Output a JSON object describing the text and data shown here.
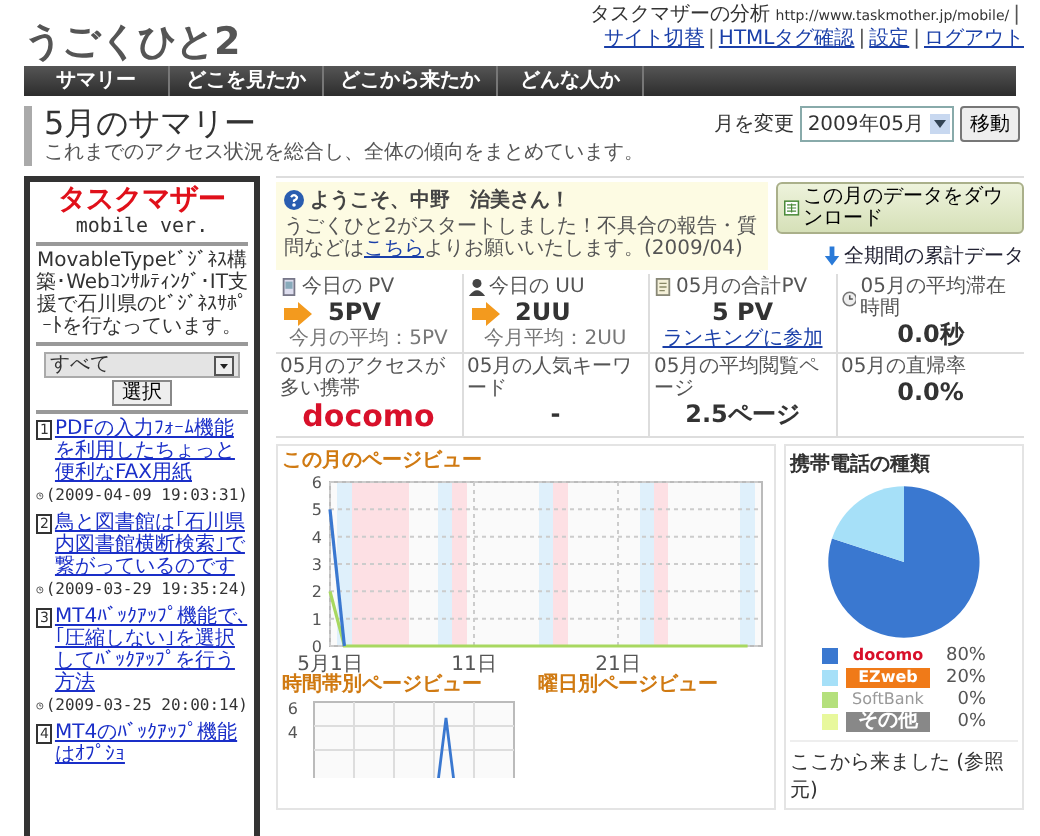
{
  "header": {
    "logo": "うごくひと2",
    "site_label": "タスクマザーの分析",
    "site_url": "http://www.taskmother.jp/mobile/",
    "separator": "|",
    "links": [
      "サイト切替",
      "HTMLタグ確認",
      "設定",
      "ログアウト"
    ]
  },
  "nav": [
    "サマリー",
    "どこを見たか",
    "どこから来たか",
    "どんな人か"
  ],
  "page": {
    "title": "5月のサマリー",
    "subtitle": "これまでのアクセス状況を総合し、全体の傾向をまとめています。",
    "month_label": "月を変更",
    "month_value": "2009年05月",
    "go_button": "移動"
  },
  "sidebar": {
    "logo": "タスクマザー",
    "edition": "mobile ver.",
    "description": "MovableTypeﾋﾞｼﾞﾈｽ構築･Webｺﾝｻﾙﾃｨﾝｸﾞ･IT支援で石川県のﾋﾞｼﾞﾈｽｻﾎﾟｰﾄを行なっています。",
    "category_value": "すべて",
    "select_button": "選択",
    "articles": [
      {
        "key": "1",
        "title": "PDFの入力ﾌｫｰﾑ機能を利用したちょっと便利なFAX用紙",
        "date": "(2009-04-09 19:03:31)"
      },
      {
        "key": "2",
        "title": "鳥と図書館は｢石川県内図書館横断検索｣で繋がっているのです",
        "date": "(2009-03-29 19:35:24)"
      },
      {
        "key": "3",
        "title": "MT4ﾊﾞｯｸｱｯﾌﾟ機能で､｢圧縮しない｣を選択してﾊﾞｯｸｱｯﾌﾟを行う方法",
        "date": "(2009-03-25 20:00:14)"
      },
      {
        "key": "4",
        "title": "MT4のﾊﾞｯｸｱｯﾌﾟ機能はｵﾌﾟｼｮ"
      }
    ]
  },
  "welcome": {
    "title": "ようこそ、中野　治美さん！",
    "text_before": "うごくひと2がスタートしました！不具合の報告・質問などは",
    "link": "こちら",
    "text_after": "よりお願いいたします。(2009/04)"
  },
  "actions": {
    "download": "この月のデータをダウンロード",
    "all_period": "全期間の累計データ"
  },
  "stats": [
    {
      "kind": "today",
      "label": "今日の PV",
      "value": "5PV",
      "note": "今月の平均：5PV"
    },
    {
      "kind": "today",
      "label": "今日の UU",
      "value": "2UU",
      "note": "今月平均：2UU"
    },
    {
      "kind": "total",
      "label": "05月の合計PV",
      "value": "5 PV",
      "link": "ランキングに参加"
    },
    {
      "kind": "time",
      "label": "05月の平均滞在時間",
      "value": "0.0秒"
    },
    {
      "kind": "logo",
      "label": "05月のアクセスが多い携帯",
      "value": "docomo"
    },
    {
      "kind": "plain",
      "label": "05月の人気キーワード",
      "value": "-"
    },
    {
      "kind": "plain",
      "label": "05月の平均閲覧ページ",
      "value": "2.5ページ"
    },
    {
      "kind": "plain",
      "label": "05月の直帰率",
      "value": "0.0%"
    }
  ],
  "month_chart": {
    "title": "この月のページビュー",
    "chart_data": {
      "type": "line",
      "x": [
        1,
        2,
        3,
        4,
        5,
        6,
        7,
        8,
        9,
        10,
        11,
        12,
        13,
        14,
        15,
        16,
        17,
        18,
        19,
        20,
        21,
        22,
        23,
        24,
        25,
        26,
        27,
        28,
        29,
        30
      ],
      "series": [
        {
          "color": "#3a78d0",
          "values": [
            5,
            0,
            null,
            null,
            null,
            null,
            null,
            null,
            null,
            null,
            null,
            null,
            null,
            null,
            null,
            null,
            null,
            null,
            null,
            null,
            null,
            null,
            null,
            null,
            null,
            null,
            null,
            null,
            null,
            null
          ]
        },
        {
          "color": "#a8d860",
          "values": [
            2,
            0,
            0,
            0,
            0,
            0,
            0,
            0,
            0,
            0,
            0,
            0,
            0,
            0,
            0,
            0,
            0,
            0,
            0,
            0,
            0,
            0,
            0,
            0,
            0,
            0,
            0,
            0,
            0,
            0
          ]
        }
      ],
      "xlim": [
        1,
        31
      ],
      "ylim": [
        0,
        6
      ],
      "yticks": [
        0,
        1,
        2,
        3,
        4,
        5,
        6
      ],
      "xticks": [
        {
          "value": 1,
          "label": "5月1日"
        },
        {
          "value": 11,
          "label": "11日"
        },
        {
          "value": 21,
          "label": "21日"
        }
      ],
      "grid": true
    }
  },
  "hour_chart": {
    "title": "時間帯別ページビュー",
    "axis_labels": [
      "6",
      "4"
    ]
  },
  "weekday_chart": {
    "title": "曜日別ページビュー"
  },
  "carrier_chart": {
    "title": "携帯電話の種類",
    "chart_data": {
      "type": "pie",
      "categories": [
        "docomo",
        "EZweb",
        "SoftBank",
        "その他"
      ],
      "values": [
        80,
        20,
        0,
        0
      ],
      "colors": [
        "#3a78d0",
        "#a6e0f8",
        "#b4e07c",
        "#e8f89c"
      ],
      "value_labels": [
        "80%",
        "20%",
        "0%",
        "0%"
      ]
    }
  },
  "referrer": {
    "title": "ここから来ました (参照元)"
  }
}
